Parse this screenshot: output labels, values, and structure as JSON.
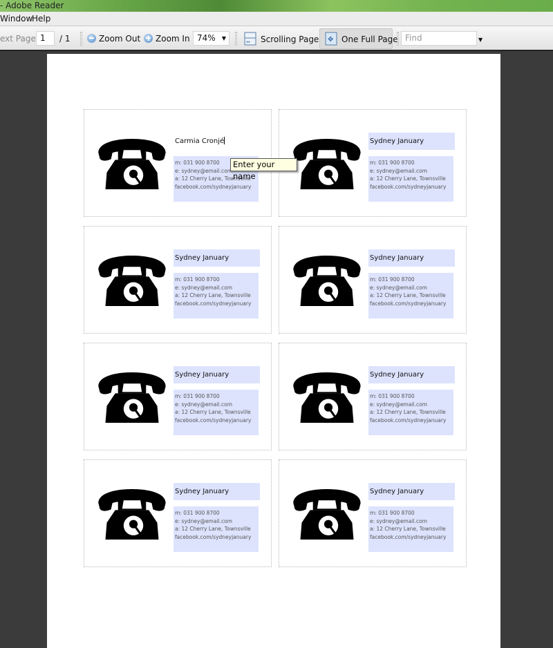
{
  "window": {
    "title": "- Adobe Reader"
  },
  "menu": [
    "Window",
    "Help"
  ],
  "toolbar": {
    "next_page": "ext Page",
    "page_number": "1",
    "page_total": "/ 1",
    "zoom_out": "Zoom Out",
    "zoom_in": "Zoom In",
    "zoom_value": "74%",
    "scrolling_pages": "Scrolling Pages",
    "one_full_page": "One Full Page",
    "find_placeholder": "Find"
  },
  "tooltip": "Enter your name",
  "cards": [
    {
      "name": "Carmia Cronjé",
      "editing": true,
      "lines": [
        "m: 031 900 8700",
        "e: sydney@email.com",
        "a: 12 Cherry Lane, Townsville",
        "facebook.com/sydneyjanuary"
      ]
    },
    {
      "name": "Sydney January",
      "lines": [
        "m: 031 900 8700",
        "e: sydney@email.com",
        "a: 12 Cherry Lane, Townsville",
        "facebook.com/sydneyjanuary"
      ]
    },
    {
      "name": "Sydney January",
      "lines": [
        "m: 031 900 8700",
        "e: sydney@email.com",
        "a: 12 Cherry Lane, Townsville",
        "facebook.com/sydneyjanuary"
      ]
    },
    {
      "name": "Sydney January",
      "lines": [
        "m: 031 900 8700",
        "e: sydney@email.com",
        "a: 12 Cherry Lane, Townsville",
        "facebook.com/sydneyjanuary"
      ]
    },
    {
      "name": "Sydney January",
      "lines": [
        "m: 031 900 8700",
        "e: sydney@email.com",
        "a: 12 Cherry Lane, Townsville",
        "facebook.com/sydneyjanuary"
      ]
    },
    {
      "name": "Sydney January",
      "lines": [
        "m: 031 900 8700",
        "e: sydney@email.com",
        "a: 12 Cherry Lane, Townsville",
        "facebook.com/sydneyjanuary"
      ]
    },
    {
      "name": "Sydney January",
      "lines": [
        "m: 031 900 8700",
        "e: sydney@email.com",
        "a: 12 Cherry Lane, Townsville",
        "facebook.com/sydneyjanuary"
      ]
    },
    {
      "name": "Sydney January",
      "lines": [
        "m: 031 900 8700",
        "e: sydney@email.com",
        "a: 12 Cherry Lane, Townsville",
        "facebook.com/sydneyjanuary"
      ]
    }
  ],
  "colors": {
    "field_fill": "#dde3fd",
    "titlebar": "#6aa84a",
    "background": "#3b3b3b"
  },
  "icons": {
    "card_icon": "telephone-icon"
  }
}
